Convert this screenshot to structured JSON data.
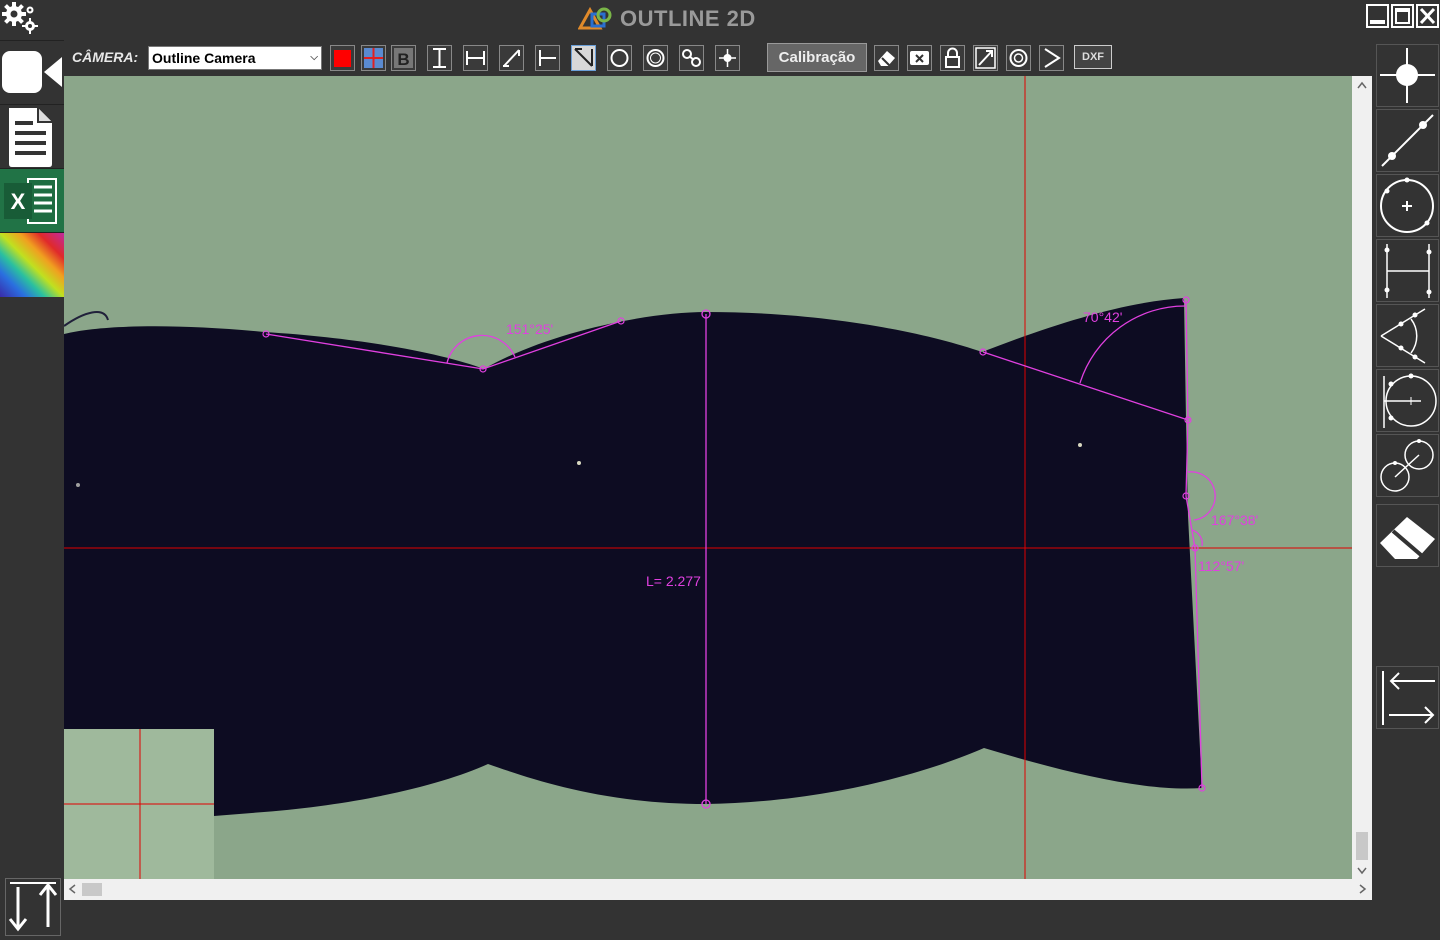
{
  "app": {
    "title": "OUTLINE 2D"
  },
  "colors": {
    "accent_magenta": "#e040e0",
    "crosshair_red": "#e00000",
    "background_green": "#8ba68a",
    "part_dark": "#0d0c22"
  },
  "toolbar": {
    "camera_label": "CÂMERA:",
    "camera_value": "Outline Camera",
    "calibration_label": "Calibração",
    "dxf_label": "DXF",
    "tools": [
      "color-red-icon",
      "crosshair-icon",
      "bold-b-icon",
      "vertical-distance-icon",
      "horizontal-distance-icon",
      "diagonal-distance-icon",
      "point-line-distance-icon",
      "angle-icon",
      "circle-3pt-icon",
      "circle-icon",
      "circle-distance-icon",
      "point-icon"
    ],
    "edit_tools": [
      "eraser-icon",
      "delete-icon",
      "lock-icon",
      "resize-icon",
      "circle-outline-icon",
      "play-icon"
    ]
  },
  "leftbar": {
    "items": [
      "camera-icon",
      "document-icon",
      "excel-icon",
      "color-palette-icon"
    ]
  },
  "rightbar": {
    "items": [
      "point-tool-icon",
      "line-tool-icon",
      "circle-tool-icon",
      "distance-tool-icon",
      "angle-tool-icon",
      "circle-center-tool-icon",
      "circle-to-circle-tool-icon",
      "eraser-tool-icon",
      "arrows-tool-icon"
    ]
  },
  "measurements": {
    "angle_1": "151°25'",
    "angle_2": "70°42'",
    "angle_3": "167°38'",
    "angle_4": "112°57'",
    "length": "L= 2.277"
  }
}
